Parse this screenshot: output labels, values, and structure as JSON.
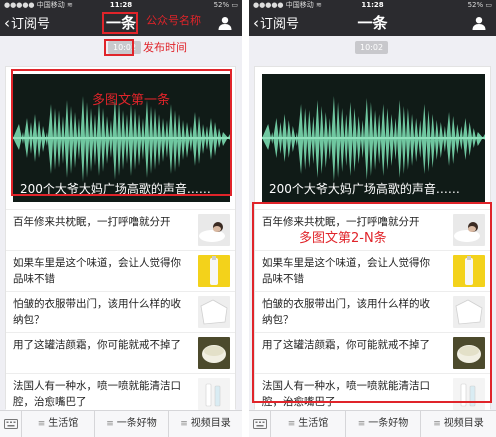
{
  "left": {
    "status": {
      "carrier": "●●●●● 中国移动 ≋",
      "time": "11:28",
      "battery": "52% ▭"
    },
    "nav": {
      "back_label": "订阅号",
      "title": "一条"
    },
    "time_pill": "10:02",
    "lead": {
      "title": "200个大爷大妈广场高歌的声音……"
    },
    "items": [
      {
        "text": "百年修来共枕眠，一打呼噜就分开"
      },
      {
        "text": "如果车里是这个味道，会让人觉得你品味不错"
      },
      {
        "text": "怕皱的衣服带出门，该用什么样的收纳包？"
      },
      {
        "text": "用了这罐洁颜霜，你可能就戒不掉了"
      },
      {
        "text": "法国人有一种水，喷一喷就能清洁口腔，治愈嘴巴了"
      }
    ],
    "tabs": {
      "tab1": "生活馆",
      "tab2": "一条好物",
      "tab3": "视频目录"
    },
    "annotations": {
      "account_name": "公众号名称",
      "publish_time": "发布时间",
      "lead_article": "多图文第一条"
    }
  },
  "right": {
    "status": {
      "carrier": "●●●●● 中国移动 ≋",
      "time": "11:28",
      "battery": "52% ▭"
    },
    "nav": {
      "back_label": "订阅号",
      "title": "一条"
    },
    "time_pill": "10:02",
    "lead": {
      "title": "200个大爷大妈广场高歌的声音……"
    },
    "items": [
      {
        "text": "百年修来共枕眠，一打呼噜就分开"
      },
      {
        "text": "如果车里是这个味道，会让人觉得你品味不错"
      },
      {
        "text": "怕皱的衣服带出门，该用什么样的收纳包？"
      },
      {
        "text": "用了这罐洁颜霜，你可能就戒不掉了"
      },
      {
        "text": "法国人有一种水，喷一喷就能清洁口腔，治愈嘴巴了"
      }
    ],
    "tabs": {
      "tab1": "生活馆",
      "tab2": "一条好物",
      "tab3": "视频目录"
    },
    "annotations": {
      "secondary_articles": "多图文第2-N条"
    }
  },
  "colors": {
    "header_bg": "#2b2b2f",
    "annotation_red": "#e0242a",
    "waveform_green": "#6fc7a0",
    "page_bg": "#efeff4"
  },
  "icons": {
    "back": "chevron-left-icon",
    "user": "user-icon",
    "keyboard": "keyboard-icon",
    "menu": "menu-icon"
  }
}
